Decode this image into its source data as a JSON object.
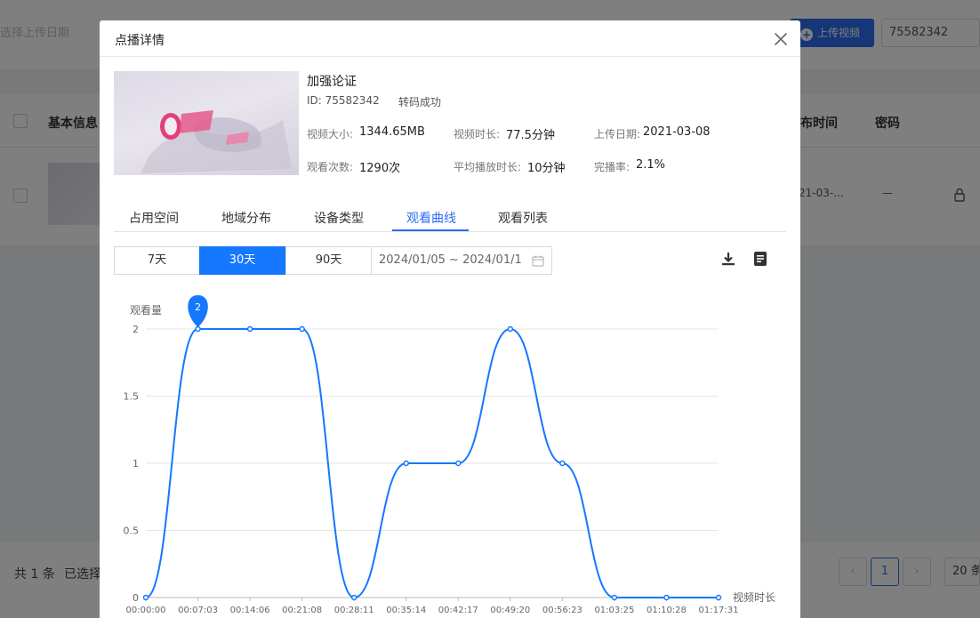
{
  "background": {
    "date_placeholder": "选择上传日期",
    "upload_label": "上传视频",
    "search_value": "75582342",
    "columns": [
      "基本信息",
      "布时间",
      "密码"
    ],
    "row_date": "21-03-...",
    "row_password": "—",
    "footer_total": "共 1 条",
    "footer_selected": "已选择",
    "page_current": "1",
    "page_prev": "‹",
    "page_next": "›",
    "page_size": "20 条"
  },
  "modal": {
    "title": "点播详情",
    "close_icon": "close-icon"
  },
  "video": {
    "title": "加强论证",
    "id_label": "ID: 75582342",
    "status": "转码成功",
    "stats": [
      {
        "label": "视频大小:",
        "value": "1344.65MB"
      },
      {
        "label": "视频时长:",
        "value": "77.5分钟"
      },
      {
        "label": "上传日期:",
        "value": "2021-03-08"
      },
      {
        "label": "观看次数:",
        "value": "1290次"
      },
      {
        "label": "平均播放时长:",
        "value": "10分钟"
      },
      {
        "label": "完播率:",
        "value": "2.1%"
      }
    ]
  },
  "tabs": [
    "占用空间",
    "地域分布",
    "设备类型",
    "观看曲线",
    "观看列表"
  ],
  "active_tab": "观看曲线",
  "range": {
    "buttons": [
      "7天",
      "30天",
      "90天"
    ],
    "active": "30天",
    "date_range": "2024/01/05 ~ 2024/01/1"
  },
  "toolbar": {
    "download_icon": "download-icon",
    "list_icon": "list-icon"
  },
  "chart_data": {
    "type": "line",
    "ylabel": "观看量",
    "xlabel": "视频时长",
    "ylim": [
      0,
      2
    ],
    "yticks": [
      "0",
      "0.5",
      "1",
      "1.5",
      "2"
    ],
    "x": [
      "00:00:00",
      "00:07:03",
      "00:14:06",
      "00:21:08",
      "00:28:11",
      "00:35:14",
      "00:42:17",
      "00:49:20",
      "00:56:23",
      "01:03:25",
      "01:10:28",
      "01:17:31"
    ],
    "values": [
      0,
      2,
      2,
      2,
      0,
      1,
      1,
      2,
      1,
      0,
      0,
      0
    ],
    "marker_label": "2",
    "line_color": "#1677ff",
    "grid": true
  }
}
